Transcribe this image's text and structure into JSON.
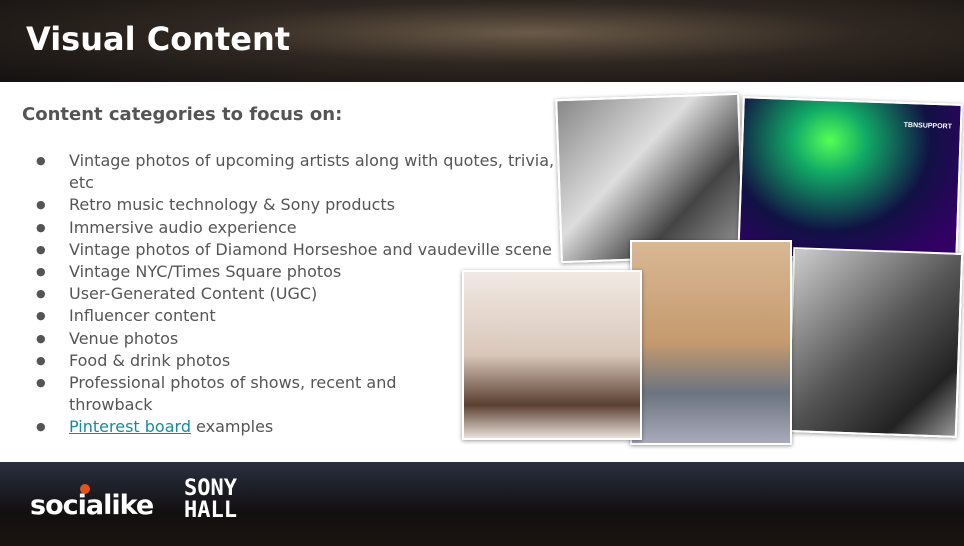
{
  "title": "Visual Content",
  "subtitle": "Content categories to focus on:",
  "items": [
    "Vintage photos of upcoming artists along with quotes, trivia, etc",
    "Retro music technology & Sony products",
    "Immersive audio experience",
    "Vintage photos of Diamond Horseshoe and vaudeville scene",
    "Vintage NYC/Times Square photos",
    "User-Generated Content (UGC)",
    "Influencer content",
    "Venue photos",
    "Food & drink photos",
    "Professional photos of shows, recent and throwback"
  ],
  "last_item": {
    "link": "Pinterest board",
    "rest": " examples"
  },
  "photo_tag": "TBNSUPPORT",
  "logos": {
    "socialike": "socialike",
    "sony_hall_1": "SONY",
    "sony_hall_2": "HALL"
  }
}
